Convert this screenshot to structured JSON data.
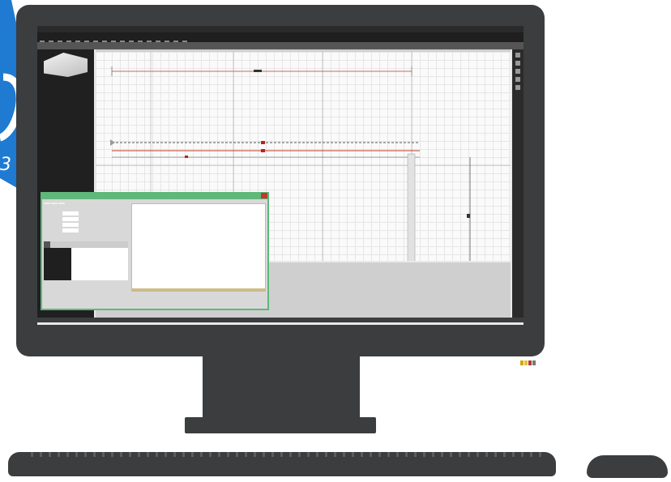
{
  "colors": {
    "monitor": "#3b3d3f",
    "badge_blue": "#1f7ad1",
    "dialog_green": "#5fb87a",
    "red_line": "#c0392b"
  },
  "window": {
    "title": ""
  },
  "tabs": [
    {
      "label": ""
    },
    {
      "label": ""
    },
    {
      "label": ""
    },
    {
      "label": ""
    },
    {
      "label": ""
    },
    {
      "label": ""
    },
    {
      "label": ""
    }
  ],
  "sidebar": {
    "project_label": "",
    "items": [
      {
        "label": ""
      },
      {
        "label": ""
      },
      {
        "label": ""
      },
      {
        "label": ""
      },
      {
        "label": ""
      },
      {
        "label": ""
      },
      {
        "label": ""
      }
    ]
  },
  "dialog": {
    "title": "",
    "tabs": [
      {
        "label": ""
      },
      {
        "label": ""
      },
      {
        "label": ""
      }
    ],
    "fields": [
      {
        "label": "",
        "value": ""
      },
      {
        "label": "",
        "value": ""
      },
      {
        "label": "",
        "value": ""
      },
      {
        "label": "",
        "value": ""
      }
    ],
    "table_tabs": [
      {
        "label": ""
      },
      {
        "label": ""
      },
      {
        "label": ""
      }
    ],
    "rows": [
      {
        "key": "",
        "value": ""
      },
      {
        "key": "",
        "value": ""
      },
      {
        "key": "",
        "value": ""
      },
      {
        "key": "",
        "value": ""
      },
      {
        "key": "",
        "value": ""
      }
    ]
  },
  "icons": {
    "badge": "logo-badge-icon",
    "close": "close-icon",
    "leds": "status-led-icon"
  }
}
